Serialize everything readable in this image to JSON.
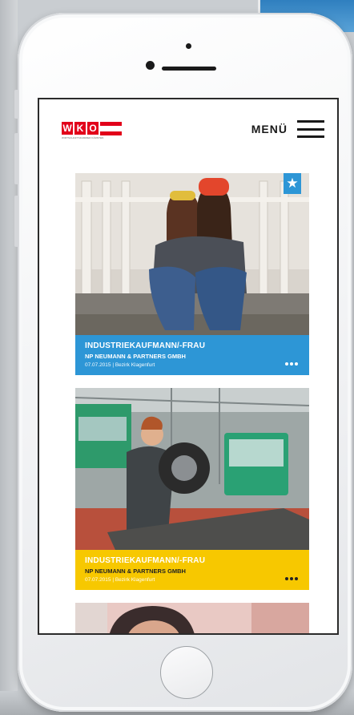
{
  "header": {
    "logo_letters": [
      "W",
      "K",
      "O"
    ],
    "logo_subtitle": "WIRTSCHAFTSKAMMER KÄRNTEN",
    "menu_label": "MENÜ"
  },
  "cards": [
    {
      "title": "INDUSTRIEKAUFMANN/-FRAU",
      "company": "NP NEUMANN & PARTNERS GMBH",
      "meta": "07.07.2015 | Bezirk Klagenfurt",
      "color": "#2d96d6",
      "badge_icon": "star-icon"
    },
    {
      "title": "INDUSTRIEKAUFMANN/-FRAU",
      "company": "NP NEUMANN & PARTNERS GMBH",
      "meta": "07.07.2015 | Bezirk Klagenfurt",
      "color": "#f7c800"
    }
  ],
  "colors": {
    "brand_red": "#e2001a"
  }
}
